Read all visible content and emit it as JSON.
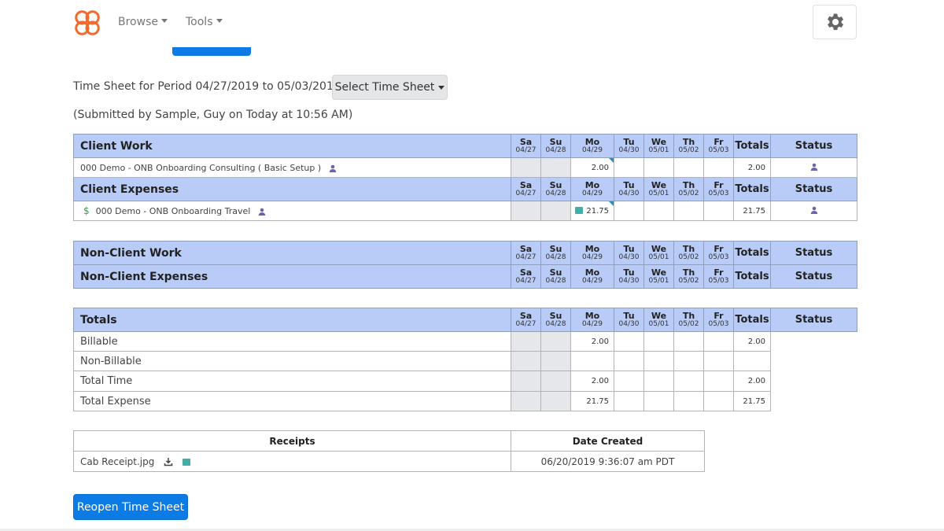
{
  "nav": {
    "browse": "Browse",
    "tools": "Tools"
  },
  "period": {
    "label": "Time Sheet for Period 04/27/2019 to 05/03/2019",
    "select_label": "Select Time Sheet",
    "submitted": "(Submitted by Sample, Guy on Today at 10:56 AM)"
  },
  "days": [
    {
      "d": "Sa",
      "dt": "04/27"
    },
    {
      "d": "Su",
      "dt": "04/28"
    },
    {
      "d": "Mo",
      "dt": "04/29"
    },
    {
      "d": "Tu",
      "dt": "04/30"
    },
    {
      "d": "We",
      "dt": "05/01"
    },
    {
      "d": "Th",
      "dt": "05/02"
    },
    {
      "d": "Fr",
      "dt": "05/03"
    }
  ],
  "headers": {
    "totals": "Totals",
    "status": "Status"
  },
  "client": {
    "work_title": "Client Work",
    "work_row": {
      "label": "000 Demo - ONB Onboarding Consulting ( Basic Setup )",
      "mo": "2.00",
      "total": "2.00"
    },
    "expenses_title": "Client Expenses",
    "expense_row": {
      "label": "000 Demo - ONB Onboarding Travel",
      "mo": "21.75",
      "total": "21.75"
    }
  },
  "nonclient": {
    "work_title": "Non-Client Work",
    "expenses_title": "Non-Client Expenses"
  },
  "totals": {
    "title": "Totals",
    "rows": [
      {
        "label": "Billable",
        "mo": "2.00",
        "total": "2.00"
      },
      {
        "label": "Non-Billable",
        "mo": "",
        "total": ""
      },
      {
        "label": "Total Time",
        "mo": "2.00",
        "total": "2.00"
      },
      {
        "label": "Total Expense",
        "mo": "21.75",
        "total": "21.75"
      }
    ]
  },
  "receipts": {
    "col_receipts": "Receipts",
    "col_date": "Date Created",
    "file": "Cab Receipt.jpg",
    "date": "06/20/2019 9:36:07 am PDT"
  },
  "reopen_label": "Reopen Time Sheet",
  "colors": {
    "header_bg": "#b9ccf7",
    "primary": "#0d7be6",
    "weekend": "#e5e7ea"
  }
}
